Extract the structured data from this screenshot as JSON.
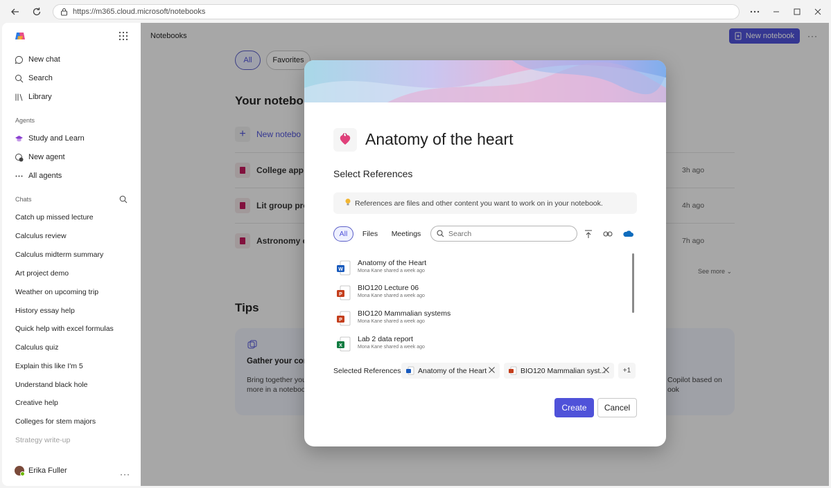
{
  "browser": {
    "url": "https://m365.cloud.microsoft/notebooks"
  },
  "sidebar": {
    "nav": [
      {
        "label": "New chat",
        "icon": "chat-icon"
      },
      {
        "label": "Search",
        "icon": "search-icon"
      },
      {
        "label": "Library",
        "icon": "library-icon"
      }
    ],
    "agents_heading": "Agents",
    "agents": [
      {
        "label": "Study and Learn",
        "icon": "study-agent-icon"
      },
      {
        "label": "New agent",
        "icon": "new-agent-icon"
      },
      {
        "label": "All agents",
        "icon": "more-icon"
      }
    ],
    "chats_heading": "Chats",
    "chats": [
      "Catch up missed lecture",
      "Calculus review",
      "Calculus midterm summary",
      "Art project demo",
      "Weather on upcoming trip",
      "History essay help",
      "Quick help with excel formulas",
      "Calculus quiz",
      "Explain this like I'm 5",
      "Understand black hole",
      "Creative help",
      "Colleges for stem majors",
      "Strategy write-up"
    ],
    "user_name": "Erika Fuller"
  },
  "main": {
    "breadcrumb": "Notebooks",
    "new_notebook_label": "New notebook",
    "filters": [
      "All",
      "Favorites"
    ],
    "section_title": "Your notebo",
    "new_notebook_row": "New notebo",
    "notebooks": [
      {
        "title": "College app r",
        "time": "3h ago"
      },
      {
        "title": "Lit group proj",
        "time": "4h ago"
      },
      {
        "title": "Astronomy cl",
        "time": "7h ago"
      }
    ],
    "see_more": "See more",
    "tips_title": "Tips",
    "tip": {
      "heading": "Gather your con",
      "body_line1": "Bring together your",
      "body_line2": "more in a notebook",
      "right_line1": "Copilot based on",
      "right_line2": "ook"
    }
  },
  "dialog": {
    "title": "Anatomy of the heart",
    "subtitle": "Select References",
    "info": "References are files and other content you want to work on in your notebook.",
    "tabs": [
      "All",
      "Files",
      "Meetings"
    ],
    "search_placeholder": "Search",
    "files": [
      {
        "name": "Anatomy of the Heart",
        "sub": "Mona Kane shared a week ago",
        "type": "word"
      },
      {
        "name": "BIO120 Lecture 06",
        "sub": "Mona Kane shared a week ago",
        "type": "powerpoint"
      },
      {
        "name": "BIO120 Mammalian systems",
        "sub": "Mona Kane shared a week ago",
        "type": "powerpoint"
      },
      {
        "name": "Lab 2 data report",
        "sub": "Mona Kane shared a week ago",
        "type": "excel"
      }
    ],
    "selected_label": "Selected References:",
    "selected": [
      {
        "name": "Anatomy of the Heart",
        "type": "word"
      },
      {
        "name": "BIO120 Mammalian syst...",
        "type": "powerpoint"
      }
    ],
    "more_count": "+1",
    "create_label": "Create",
    "cancel_label": "Cancel"
  },
  "colors": {
    "accent": "#4f52d9",
    "word": "#185abd",
    "powerpoint": "#c43e1c",
    "excel": "#107c41"
  }
}
